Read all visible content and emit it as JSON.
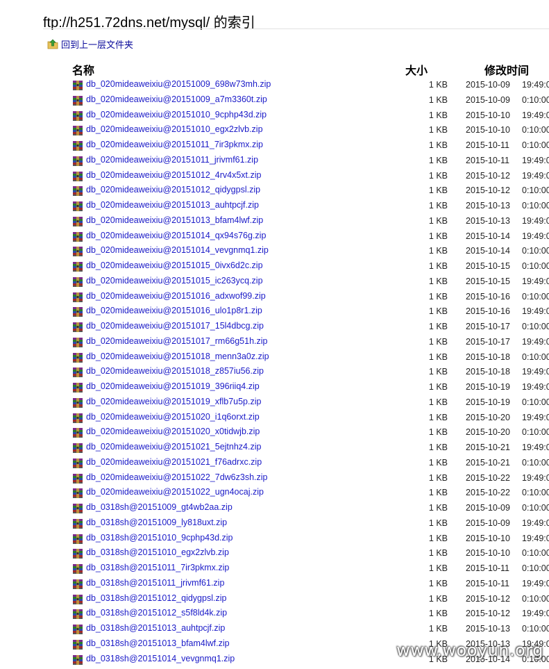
{
  "page": {
    "title": "ftp://h251.72dns.net/mysql/ 的索引",
    "up_link": "回到上一层文件夹"
  },
  "columns": {
    "name": "名称",
    "size": "大小",
    "modified": "修改时间"
  },
  "files": [
    {
      "name": "db_020mideaweixiu@20151009_698w73mh.zip",
      "size": "1 KB",
      "date": "2015-10-09",
      "time": "19:49:0"
    },
    {
      "name": "db_020mideaweixiu@20151009_a7m3360t.zip",
      "size": "1 KB",
      "date": "2015-10-09",
      "time": "0:10:00"
    },
    {
      "name": "db_020mideaweixiu@20151010_9cphp43d.zip",
      "size": "1 KB",
      "date": "2015-10-10",
      "time": "19:49:0"
    },
    {
      "name": "db_020mideaweixiu@20151010_egx2zlvb.zip",
      "size": "1 KB",
      "date": "2015-10-10",
      "time": "0:10:00"
    },
    {
      "name": "db_020mideaweixiu@20151011_7ir3pkmx.zip",
      "size": "1 KB",
      "date": "2015-10-11",
      "time": "0:10:00"
    },
    {
      "name": "db_020mideaweixiu@20151011_jrivmf61.zip",
      "size": "1 KB",
      "date": "2015-10-11",
      "time": "19:49:0"
    },
    {
      "name": "db_020mideaweixiu@20151012_4rv4x5xt.zip",
      "size": "1 KB",
      "date": "2015-10-12",
      "time": "19:49:0"
    },
    {
      "name": "db_020mideaweixiu@20151012_qidygpsl.zip",
      "size": "1 KB",
      "date": "2015-10-12",
      "time": "0:10:00"
    },
    {
      "name": "db_020mideaweixiu@20151013_auhtpcjf.zip",
      "size": "1 KB",
      "date": "2015-10-13",
      "time": "0:10:00"
    },
    {
      "name": "db_020mideaweixiu@20151013_bfam4lwf.zip",
      "size": "1 KB",
      "date": "2015-10-13",
      "time": "19:49:0"
    },
    {
      "name": "db_020mideaweixiu@20151014_qx94s76g.zip",
      "size": "1 KB",
      "date": "2015-10-14",
      "time": "19:49:0"
    },
    {
      "name": "db_020mideaweixiu@20151014_vevgnmq1.zip",
      "size": "1 KB",
      "date": "2015-10-14",
      "time": "0:10:00"
    },
    {
      "name": "db_020mideaweixiu@20151015_0ivx6d2c.zip",
      "size": "1 KB",
      "date": "2015-10-15",
      "time": "0:10:00"
    },
    {
      "name": "db_020mideaweixiu@20151015_ic263ycq.zip",
      "size": "1 KB",
      "date": "2015-10-15",
      "time": "19:49:0"
    },
    {
      "name": "db_020mideaweixiu@20151016_adxwof99.zip",
      "size": "1 KB",
      "date": "2015-10-16",
      "time": "0:10:00"
    },
    {
      "name": "db_020mideaweixiu@20151016_ulo1p8r1.zip",
      "size": "1 KB",
      "date": "2015-10-16",
      "time": "19:49:0"
    },
    {
      "name": "db_020mideaweixiu@20151017_15l4dbcg.zip",
      "size": "1 KB",
      "date": "2015-10-17",
      "time": "0:10:00"
    },
    {
      "name": "db_020mideaweixiu@20151017_rm66g51h.zip",
      "size": "1 KB",
      "date": "2015-10-17",
      "time": "19:49:0"
    },
    {
      "name": "db_020mideaweixiu@20151018_menn3a0z.zip",
      "size": "1 KB",
      "date": "2015-10-18",
      "time": "0:10:00"
    },
    {
      "name": "db_020mideaweixiu@20151018_z857iu56.zip",
      "size": "1 KB",
      "date": "2015-10-18",
      "time": "19:49:0"
    },
    {
      "name": "db_020mideaweixiu@20151019_396riiq4.zip",
      "size": "1 KB",
      "date": "2015-10-19",
      "time": "19:49:0"
    },
    {
      "name": "db_020mideaweixiu@20151019_xflb7u5p.zip",
      "size": "1 KB",
      "date": "2015-10-19",
      "time": "0:10:00"
    },
    {
      "name": "db_020mideaweixiu@20151020_i1q6orxt.zip",
      "size": "1 KB",
      "date": "2015-10-20",
      "time": "19:49:0"
    },
    {
      "name": "db_020mideaweixiu@20151020_x0tidwjb.zip",
      "size": "1 KB",
      "date": "2015-10-20",
      "time": "0:10:00"
    },
    {
      "name": "db_020mideaweixiu@20151021_5ejtnhz4.zip",
      "size": "1 KB",
      "date": "2015-10-21",
      "time": "19:49:0"
    },
    {
      "name": "db_020mideaweixiu@20151021_f76adrxc.zip",
      "size": "1 KB",
      "date": "2015-10-21",
      "time": "0:10:00"
    },
    {
      "name": "db_020mideaweixiu@20151022_7dw6z3sh.zip",
      "size": "1 KB",
      "date": "2015-10-22",
      "time": "19:49:0"
    },
    {
      "name": "db_020mideaweixiu@20151022_ugn4ocaj.zip",
      "size": "1 KB",
      "date": "2015-10-22",
      "time": "0:10:00"
    },
    {
      "name": "db_0318sh@20151009_gt4wb2aa.zip",
      "size": "1 KB",
      "date": "2015-10-09",
      "time": "0:10:00"
    },
    {
      "name": "db_0318sh@20151009_ly818uxt.zip",
      "size": "1 KB",
      "date": "2015-10-09",
      "time": "19:49:0"
    },
    {
      "name": "db_0318sh@20151010_9cphp43d.zip",
      "size": "1 KB",
      "date": "2015-10-10",
      "time": "19:49:0"
    },
    {
      "name": "db_0318sh@20151010_egx2zlvb.zip",
      "size": "1 KB",
      "date": "2015-10-10",
      "time": "0:10:00"
    },
    {
      "name": "db_0318sh@20151011_7ir3pkmx.zip",
      "size": "1 KB",
      "date": "2015-10-11",
      "time": "0:10:00"
    },
    {
      "name": "db_0318sh@20151011_jrivmf61.zip",
      "size": "1 KB",
      "date": "2015-10-11",
      "time": "19:49:0"
    },
    {
      "name": "db_0318sh@20151012_qidygpsl.zip",
      "size": "1 KB",
      "date": "2015-10-12",
      "time": "0:10:00"
    },
    {
      "name": "db_0318sh@20151012_s5f8ld4k.zip",
      "size": "1 KB",
      "date": "2015-10-12",
      "time": "19:49:0"
    },
    {
      "name": "db_0318sh@20151013_auhtpcjf.zip",
      "size": "1 KB",
      "date": "2015-10-13",
      "time": "0:10:00"
    },
    {
      "name": "db_0318sh@20151013_bfam4lwf.zip",
      "size": "1 KB",
      "date": "2015-10-13",
      "time": "19:49:0"
    },
    {
      "name": "db_0318sh@20151014_vevgnmq1.zip",
      "size": "1 KB",
      "date": "2015-10-14",
      "time": "0:10:00"
    }
  ],
  "watermark": "www.wooyun.org",
  "colors": {
    "link": "#1b1bc8",
    "text": "#222222",
    "background": "#ffffff"
  },
  "icons": {
    "up": "folder-up-icon",
    "file": "archive-file-icon"
  }
}
